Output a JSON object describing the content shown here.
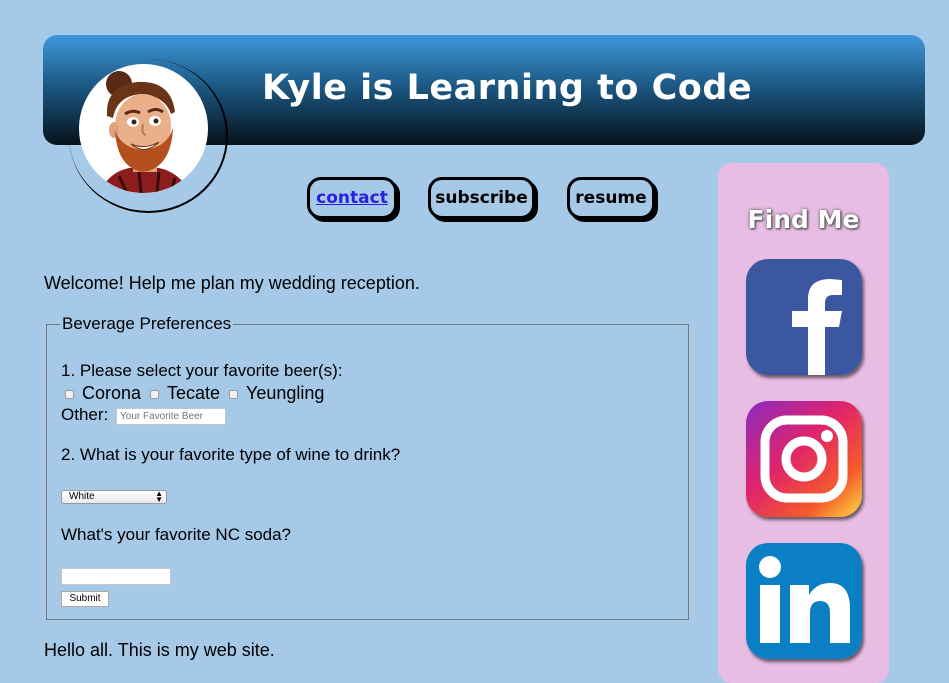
{
  "header": {
    "title": "Kyle is Learning to Code"
  },
  "nav": {
    "contact": "contact",
    "subscribe": "subscribe",
    "resume": "resume"
  },
  "main": {
    "welcome": "Welcome! Help me plan my wedding reception.",
    "form": {
      "legend": "Beverage Preferences",
      "q1": "1. Please select your favorite beer(s):",
      "beers": [
        "Corona",
        "Tecate",
        "Yeungling"
      ],
      "other_label": "Other:",
      "other_placeholder": "Your Favorite Beer",
      "q2": "2. What is your favorite type of wine to drink?",
      "wine_selected": "White",
      "q3": "What's your favorite NC soda?",
      "soda_value": "",
      "submit_label": "Submit"
    },
    "footer_text": "Hello all. This is my web site."
  },
  "sidebar": {
    "heading": "Find Me",
    "icons": [
      "facebook-icon",
      "instagram-icon",
      "linkedin-icon"
    ]
  },
  "colors": {
    "page_bg": "#a6c9e8",
    "sidebar_bg": "#e8bde3",
    "header_top": "#3e98dc",
    "header_bottom": "#06121b",
    "link": "#2a1fe0",
    "facebook": "#3b57a0",
    "linkedin": "#0a7fc4"
  }
}
